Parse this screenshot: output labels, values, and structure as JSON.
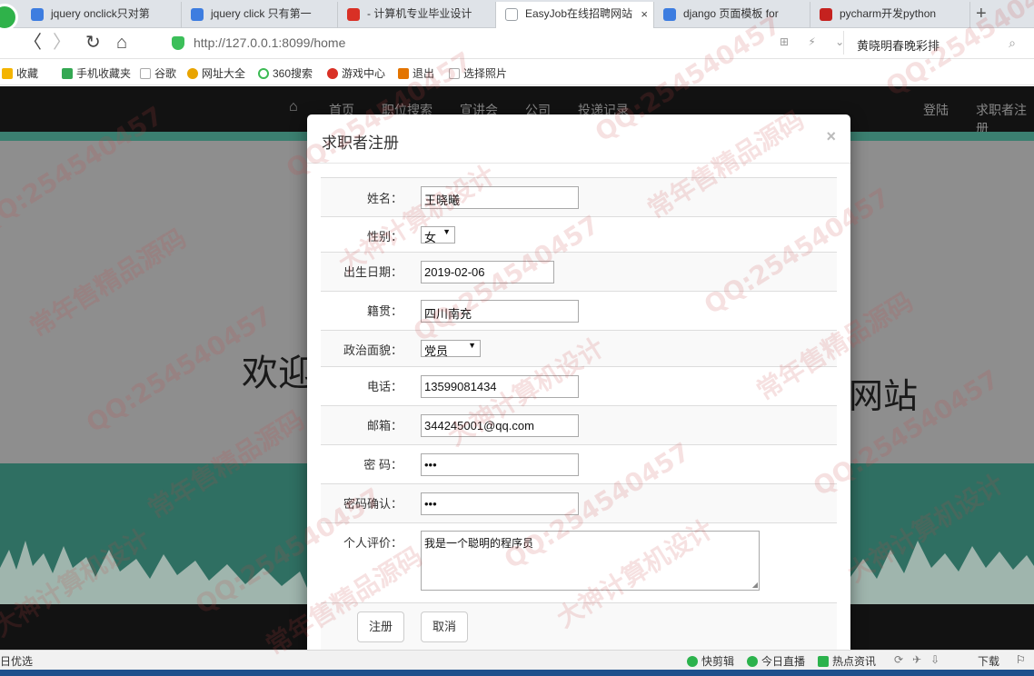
{
  "browser": {
    "tabs": [
      {
        "title": "jquery onclick只对第",
        "icon_color": "#3d7de0",
        "active": false
      },
      {
        "title": "jquery click 只有第一",
        "icon_color": "#3d7de0",
        "active": false
      },
      {
        "title": "- 计算机专业毕业设计",
        "icon_color": "#d93025",
        "active": false
      },
      {
        "title": "EasyJob在线招聘网站",
        "icon_color": "#9aa0a6",
        "active": true
      },
      {
        "title": "django 页面模板 for",
        "icon_color": "#3d7de0",
        "active": false
      },
      {
        "title": "pycharm开发python",
        "icon_color": "#c5221f",
        "active": false
      }
    ],
    "tab_close_glyph": "×",
    "new_tab_glyph": "+",
    "back_glyph": "〈",
    "forward_glyph": "〉",
    "reload_glyph": "↻",
    "home_glyph": "⌂",
    "url": "http://127.0.0.1:8099/home",
    "nav_right_icons": "⊞ ⚡ ⌄",
    "search_text": "黄晓明春晚彩排",
    "search_icon": "⌕"
  },
  "bookmarks": [
    {
      "label": "收藏",
      "icon": "star-icon",
      "color": "#f4b400"
    },
    {
      "label": "手机收藏夹",
      "icon": "phone-icon",
      "color": "#34a853"
    },
    {
      "label": "谷歌",
      "icon": "page-icon",
      "color": "#cccccc"
    },
    {
      "label": "网址大全",
      "icon": "globe-icon",
      "color": "#e8a400"
    },
    {
      "label": "360搜索",
      "icon": "search-icon",
      "color": "#3cba54"
    },
    {
      "label": "游戏中心",
      "icon": "game-icon",
      "color": "#d93025"
    },
    {
      "label": "退出",
      "icon": "exit-icon",
      "color": "#e37400"
    },
    {
      "label": "选择照片",
      "icon": "page-icon",
      "color": "#cccccc"
    }
  ],
  "site": {
    "nav": [
      "首页",
      "职位搜索",
      "宣讲会",
      "公司",
      "投递记录"
    ],
    "nav_right": [
      "登陆",
      "求职者注册"
    ],
    "home_icon": "⌂",
    "hero_left": "欢迎",
    "hero_right": "网站"
  },
  "modal": {
    "title": "求职者注册",
    "close_glyph": "×",
    "fields": {
      "name": {
        "label": "姓名：",
        "value": "王晓曦"
      },
      "gender": {
        "label": "性别：",
        "value": "女"
      },
      "birthday": {
        "label": "出生日期：",
        "value": "2019-02-06"
      },
      "hometown": {
        "label": "籍贯：",
        "value": "四川南充"
      },
      "politics": {
        "label": "政治面貌：",
        "value": "党员"
      },
      "phone": {
        "label": "电话：",
        "value": "13599081434"
      },
      "email": {
        "label": "邮箱：",
        "value": "344245001@qq.com"
      },
      "password": {
        "label": "密 码：",
        "value": "•••"
      },
      "password_confirm": {
        "label": "密码确认：",
        "value": "•••"
      },
      "bio": {
        "label": "个人评价：",
        "value": "我是一个聪明的程序员"
      }
    },
    "select_arrow": "▼",
    "buttons": {
      "register": "注册",
      "cancel": "取消"
    }
  },
  "statusbar": {
    "left": "日优选",
    "items": [
      "快剪辑",
      "今日直播",
      "热点资讯"
    ],
    "download": "下载"
  },
  "watermark": {
    "texts": [
      "QQ:254540457",
      "常年售精品源码",
      "大神计算机设计"
    ],
    "color": "#c84646"
  }
}
